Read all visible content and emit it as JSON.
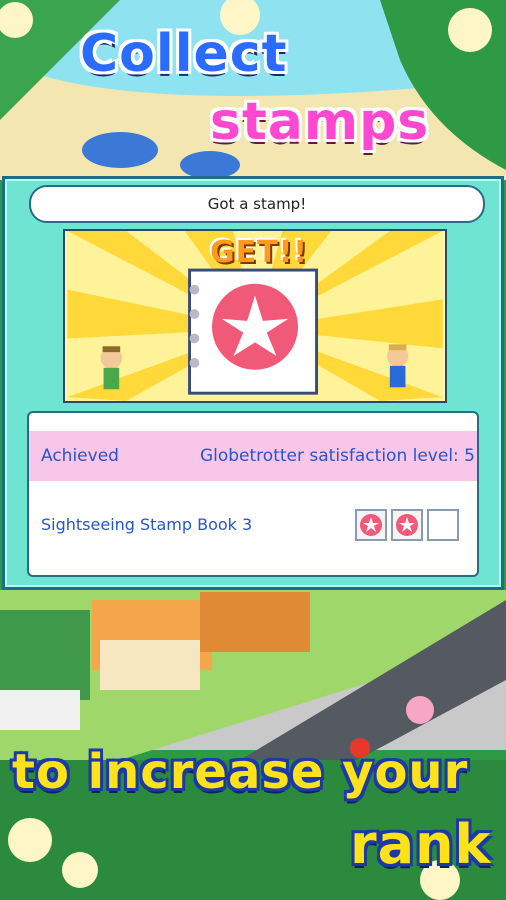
{
  "headline": {
    "line1": "Collect",
    "line2": "stamps",
    "line3": "to increase your",
    "line4": "rank"
  },
  "dialog": {
    "title": "Got a stamp!",
    "banner": "GET!!",
    "achieved_label": "Achieved",
    "achieved_value": "Globetrotter satisfaction level: 5",
    "book_label": "Sightseeing Stamp Book 3",
    "stamps": [
      {
        "filled": true,
        "icon": "hibiscus-stamp-icon"
      },
      {
        "filled": true,
        "icon": "hibiscus-stamp-icon"
      },
      {
        "filled": false,
        "icon": "empty-stamp-slot"
      }
    ]
  },
  "colors": {
    "dialog_bg": "#6fe4d2",
    "achieved_row": "#f7c6e8",
    "text_blue": "#2a55c8",
    "stamp_pink": "#f05a78"
  }
}
